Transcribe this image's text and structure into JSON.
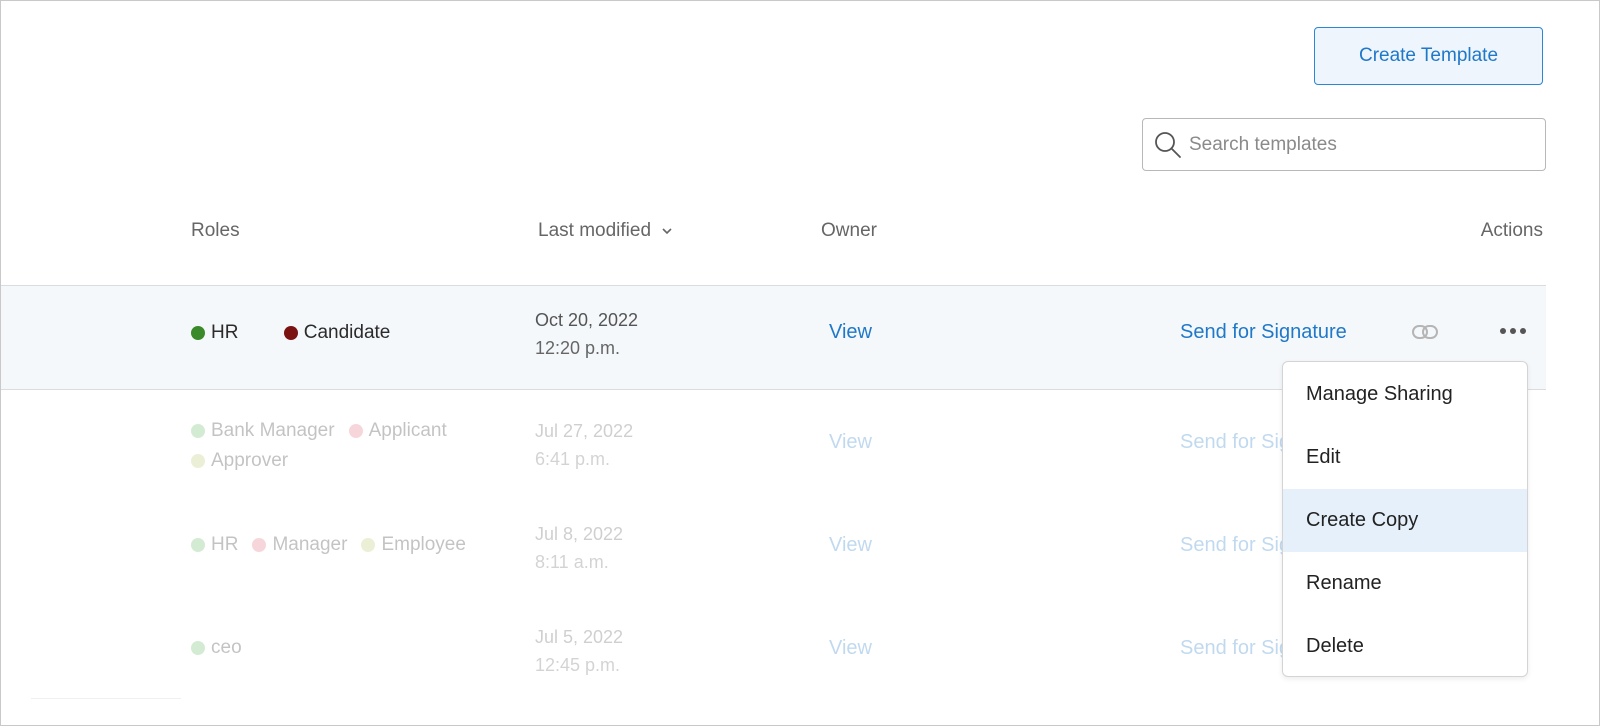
{
  "toolbar": {
    "create_label": "Create Template"
  },
  "search": {
    "placeholder": "Search templates",
    "value": ""
  },
  "columns": {
    "roles": "Roles",
    "last_modified": "Last modified",
    "owner": "Owner",
    "actions": "Actions"
  },
  "rows": [
    {
      "roles": [
        {
          "label": "HR",
          "color": "#3a8a2a"
        },
        {
          "label": "Candidate",
          "color": "#7a1212"
        }
      ],
      "date": "Oct 20, 2022",
      "time": "12:20 p.m.",
      "owner_link": "View",
      "action_label": "Send for Signature"
    },
    {
      "roles": [
        {
          "label": "Bank Manager",
          "color": "#66bb66"
        },
        {
          "label": "Applicant",
          "color": "#e07080"
        },
        {
          "label": "Approver",
          "color": "#b8c870"
        }
      ],
      "date": "Jul 27, 2022",
      "time": "6:41 p.m.",
      "owner_link": "View",
      "action_label": "Send for Sig"
    },
    {
      "roles": [
        {
          "label": "HR",
          "color": "#66bb66"
        },
        {
          "label": "Manager",
          "color": "#e07080"
        },
        {
          "label": "Employee",
          "color": "#b8c870"
        }
      ],
      "date": "Jul 8, 2022",
      "time": "8:11 a.m.",
      "owner_link": "View",
      "action_label": "Send for Sig"
    },
    {
      "roles": [
        {
          "label": "ceo",
          "color": "#66bb66"
        }
      ],
      "date": "Jul 5, 2022",
      "time": "12:45 p.m.",
      "owner_link": "View",
      "action_label": "Send for Sig"
    }
  ],
  "menu": {
    "items": [
      "Manage Sharing",
      "Edit",
      "Create Copy",
      "Rename",
      "Delete"
    ],
    "highlighted": "Create Copy"
  },
  "icons": {
    "search": "search-icon",
    "sort": "chevron-down-icon",
    "link": "link-icon",
    "more": "more-horizontal-icon"
  },
  "colors": {
    "accent": "#1f78c8",
    "row_highlight": "#f5f8fb",
    "menu_highlight": "#e6f0fb"
  }
}
